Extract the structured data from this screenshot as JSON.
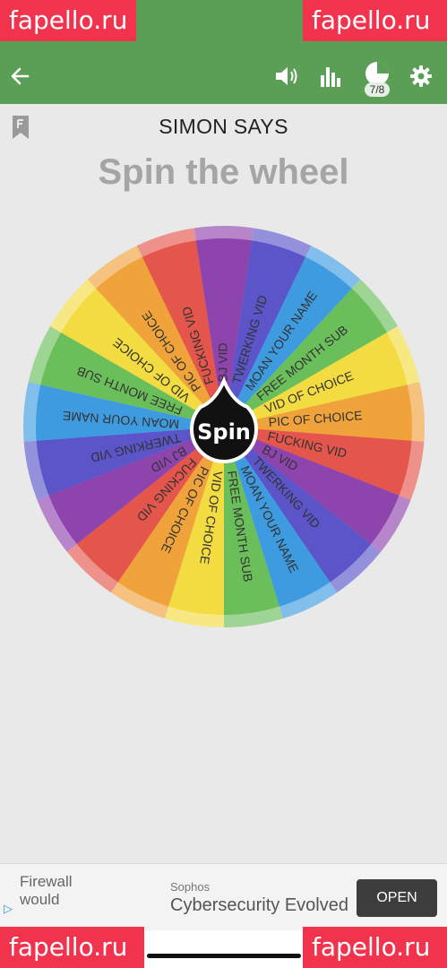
{
  "watermark": {
    "left_text": "fapello.ru",
    "right_text": "fapello.ru"
  },
  "toolbar": {
    "icons": {
      "back": "back-arrow-icon",
      "sound": "volume-icon",
      "stats": "bar-chart-icon",
      "progress": "pie-progress-icon",
      "settings": "gear-icon"
    },
    "counter": "7/8"
  },
  "game": {
    "title": "SIMON SAYS",
    "headline": "Spin the wheel",
    "spin_label": "Spin",
    "segments": [
      "BJ VID",
      "TWERKING VID",
      "MOAN YOUR NAME",
      "FREE MONTH SUB",
      "VID OF CHOICE",
      "PIC OF CHOICE",
      "FUCKING VID",
      "BJ VID",
      "TWERKING VID",
      "MOAN YOUR NAME",
      "FREE MONTH SUB",
      "VID OF CHOICE",
      "PIC OF CHOICE",
      "FUCKING VID",
      "BJ VID",
      "TWERKING VID",
      "MOAN YOUR NAME",
      "FREE MONTH SUB",
      "VID OF CHOICE",
      "PIC OF CHOICE",
      "FUCKING VID"
    ],
    "segment_colors": [
      "#8e44ad",
      "#5b55c9",
      "#3f9be0",
      "#6bbf5a",
      "#f3dc41",
      "#efa33a",
      "#e4554b"
    ]
  },
  "ad": {
    "left_text_line1": "Firewall",
    "left_text_line2": "would",
    "brand": "Sophos",
    "headline": "Cybersecurity Evolved",
    "button": "OPEN"
  },
  "colors": {
    "bar": "#5b9e55",
    "watermark": "#f2334e",
    "background": "#e9e9e9"
  }
}
